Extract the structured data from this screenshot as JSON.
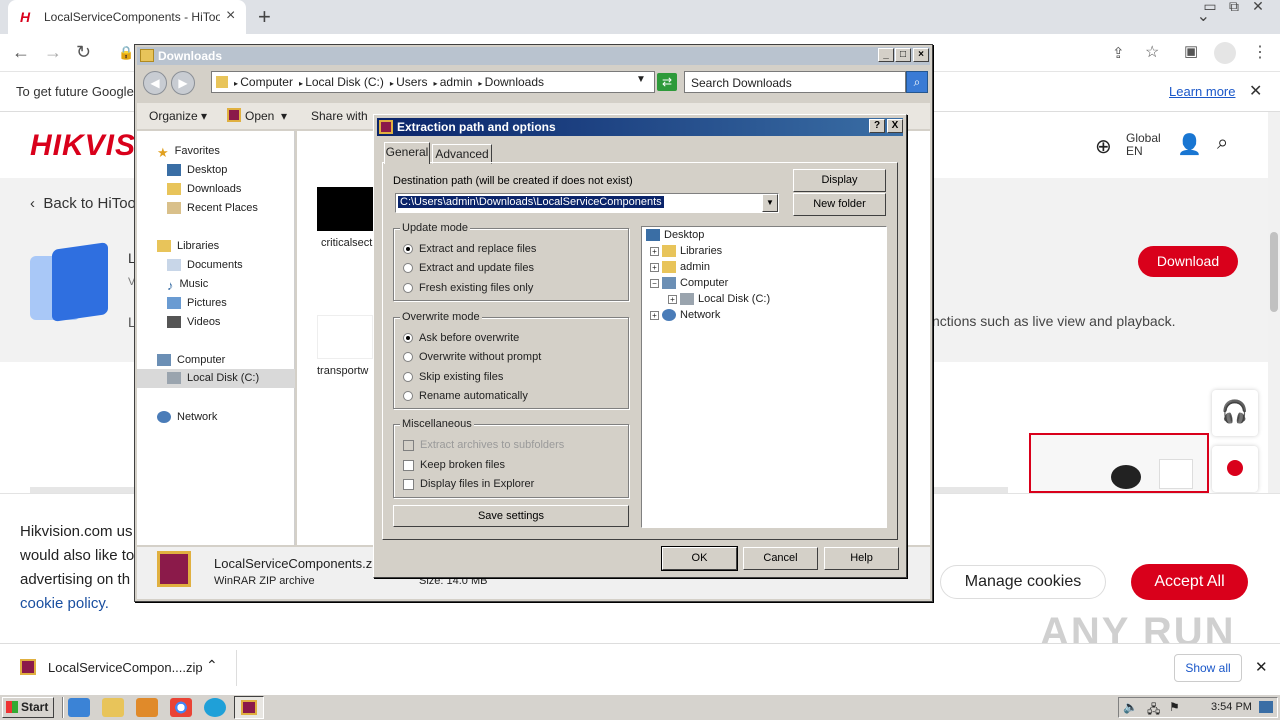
{
  "browser": {
    "tab_title": "LocalServiceComponents - HiTools - Hik",
    "tab_favicon": "H",
    "new_tab": "+",
    "infobar_text": "To get future Google",
    "learn_more": "Learn more"
  },
  "page": {
    "logo": "HIKVISION",
    "back_link": "Back to HiTools",
    "global_label": "Global",
    "lang": "EN",
    "product_letter_1": "L",
    "product_letter_2": "V",
    "product_letter_3": "L",
    "description_fragment": "nctions such as live view and playback.",
    "download_btn": "Download",
    "cookie_line1": "Hikvision.com us",
    "cookie_line2": "would also like to",
    "cookie_line3": "advertising on th",
    "cookie_link": "cookie policy.",
    "manage_cookies": "Manage cookies",
    "accept_all": "Accept All",
    "watermark": "ANY RUN"
  },
  "download_bar": {
    "file": "LocalServiceCompon....zip",
    "show_all": "Show all"
  },
  "explorer": {
    "title": "Downloads",
    "breadcrumb": [
      "Computer",
      "Local Disk (C:)",
      "Users",
      "admin",
      "Downloads"
    ],
    "search_placeholder": "Search Downloads",
    "cmd": {
      "organize": "Organize",
      "open": "Open",
      "share_with": "Share with"
    },
    "nav": {
      "favorites": "Favorites",
      "desktop": "Desktop",
      "downloads": "Downloads",
      "recent": "Recent Places",
      "libraries": "Libraries",
      "documents": "Documents",
      "music": "Music",
      "pictures": "Pictures",
      "videos": "Videos",
      "computer": "Computer",
      "local_disk": "Local Disk (C:)",
      "network": "Network"
    },
    "files": [
      "criticalsect",
      "transportw"
    ],
    "details": {
      "name": "LocalServiceComponents.zip",
      "type": "WinRAR ZIP archive",
      "size": "Size: 14.0 MB"
    }
  },
  "dialog": {
    "title": "Extraction path and options",
    "help_btn": "?",
    "close_btn": "X",
    "tabs": [
      "General",
      "Advanced"
    ],
    "dest_label": "Destination path (will be created if does not exist)",
    "dest_value": "C:\\Users\\admin\\Downloads\\LocalServiceComponents",
    "display_btn": "Display",
    "new_folder_btn": "New folder",
    "update_mode": {
      "title": "Update mode",
      "options": [
        "Extract and replace files",
        "Extract and update files",
        "Fresh existing files only"
      ],
      "selected": 0
    },
    "overwrite_mode": {
      "title": "Overwrite mode",
      "options": [
        "Ask before overwrite",
        "Overwrite without prompt",
        "Skip existing files",
        "Rename automatically"
      ],
      "selected": 0
    },
    "misc": {
      "title": "Miscellaneous",
      "options": [
        "Extract archives to subfolders",
        "Keep broken files",
        "Display files in Explorer"
      ]
    },
    "save_settings": "Save settings",
    "tree": [
      "Desktop",
      "Libraries",
      "admin",
      "Computer",
      "Local Disk (C:)",
      "Network"
    ],
    "ok": "OK",
    "cancel": "Cancel",
    "help": "Help"
  },
  "taskbar": {
    "start": "Start",
    "clock": "3:54 PM"
  }
}
